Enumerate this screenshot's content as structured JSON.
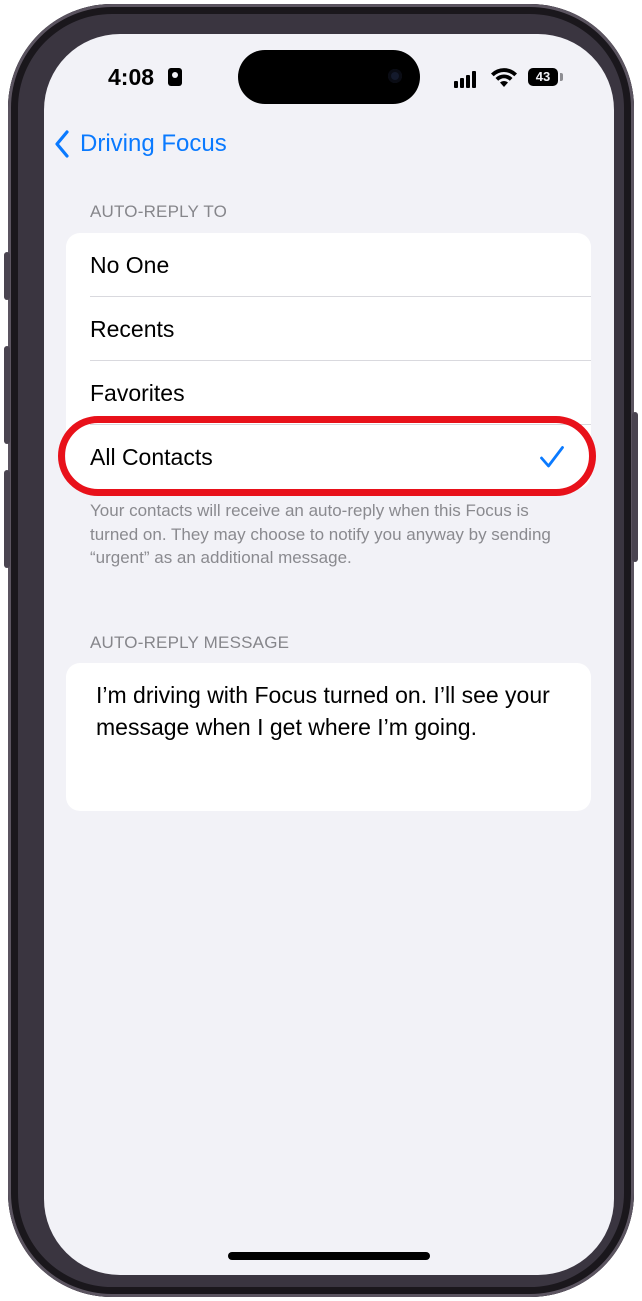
{
  "status_bar": {
    "time": "4:08",
    "battery": "43"
  },
  "nav": {
    "back_label": "Driving Focus"
  },
  "auto_reply_to": {
    "header": "AUTO-REPLY TO",
    "options": [
      {
        "label": "No One"
      },
      {
        "label": "Recents"
      },
      {
        "label": "Favorites"
      },
      {
        "label": "All Contacts",
        "selected": true
      }
    ],
    "footer": "Your contacts will receive an auto-reply when this Focus is turned on. They may choose to notify you anyway by sending “urgent” as an additional message."
  },
  "auto_reply_message": {
    "header": "AUTO-REPLY MESSAGE",
    "text": "I’m driving with Focus turned on. I’ll see your message when I get where I’m going."
  },
  "colors": {
    "accent": "#0a7aff",
    "highlight": "#e8111a",
    "background": "#f2f2f7"
  }
}
